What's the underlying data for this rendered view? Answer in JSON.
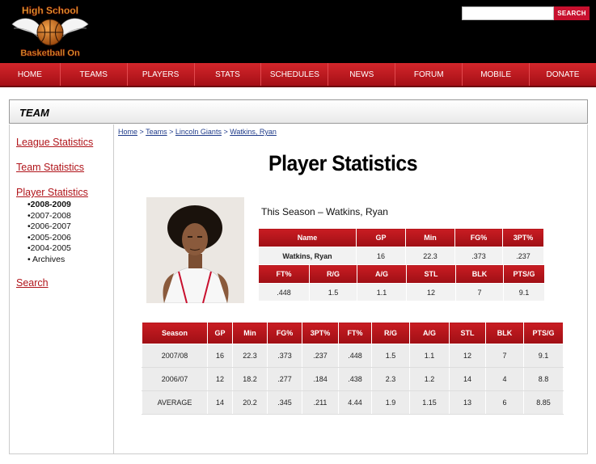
{
  "header": {
    "logo_line1": "High School",
    "logo_line2": "Basketball On",
    "search": {
      "placeholder": "",
      "button_label": "SEARCH"
    }
  },
  "nav": [
    "HOME",
    "TEAMS",
    "PLAYERS",
    "STATS",
    "SCHEDULES",
    "NEWS",
    "FORUM",
    "MOBILE",
    "DONATE"
  ],
  "section": {
    "title": "TEAM"
  },
  "sidebar": {
    "league": "League Statistics",
    "team": "Team Statistics",
    "player": "Player Statistics",
    "seasons": [
      "•2008-2009",
      "•2007-2008",
      "•2006-2007",
      "•2005-2006",
      "•2004-2005",
      "• Archives"
    ],
    "search": "Search"
  },
  "breadcrumb": {
    "home": "Home",
    "teams": "Teams",
    "team": "Lincoln Giants",
    "player": "Watkins, Ryan",
    "sep": " > "
  },
  "page": {
    "title": "Player Statistics",
    "season_caption": "This Season – Watkins, Ryan"
  },
  "this_season": {
    "top_headers": [
      "Name",
      "GP",
      "Min",
      "FG%",
      "3PT%"
    ],
    "top_row": [
      "Watkins, Ryan",
      "16",
      "22.3",
      ".373",
      ".237"
    ],
    "bottom_headers": [
      "FT%",
      "R/G",
      "A/G",
      "STL",
      "BLK",
      "PTS/G"
    ],
    "bottom_row": [
      ".448",
      "1.5",
      "1.1",
      "12",
      "7",
      "9.1"
    ]
  },
  "career": {
    "headers": [
      "Season",
      "GP",
      "Min",
      "FG%",
      "3PT%",
      "FT%",
      "R/G",
      "A/G",
      "STL",
      "BLK",
      "PTS/G"
    ],
    "rows": [
      [
        "2007/08",
        "16",
        "22.3",
        ".373",
        ".237",
        ".448",
        "1.5",
        "1.1",
        "12",
        "7",
        "9.1"
      ],
      [
        "2006/07",
        "12",
        "18.2",
        ".277",
        ".184",
        ".438",
        "2.3",
        "1.2",
        "14",
        "4",
        "8.8"
      ],
      [
        "AVERAGE",
        "14",
        "20.2",
        ".345",
        ".211",
        "4.44",
        "1.9",
        "1.15",
        "13",
        "6",
        "8.85"
      ]
    ]
  },
  "colors": {
    "nav_red": "#c8102e",
    "link_red": "#b0141a",
    "link_blue": "#1f3b8a",
    "header_bg": "#000000"
  }
}
